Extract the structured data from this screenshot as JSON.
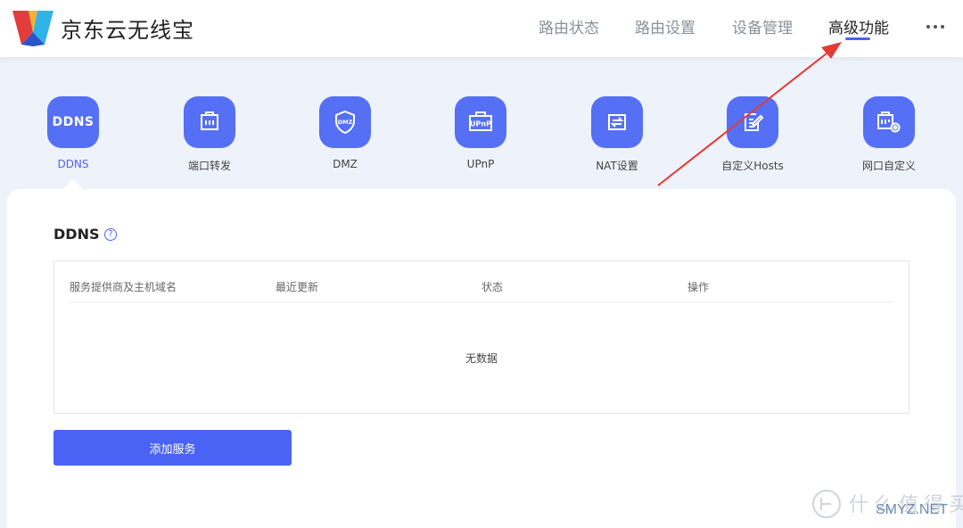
{
  "header": {
    "brand": "京东云无线宝",
    "nav": [
      {
        "label": "路由状态"
      },
      {
        "label": "路由设置"
      },
      {
        "label": "设备管理"
      },
      {
        "label": "高级功能"
      }
    ]
  },
  "tabs": [
    {
      "label": "DDNS",
      "icon_text": "DDNS"
    },
    {
      "label": "端口转发"
    },
    {
      "label": "DMZ",
      "icon_text": "DMZ"
    },
    {
      "label": "UPnP",
      "icon_text": "UPnP"
    },
    {
      "label": "NAT设置"
    },
    {
      "label": "自定义Hosts"
    },
    {
      "label": "网口自定义"
    }
  ],
  "section": {
    "title": "DDNS",
    "help_symbol": "?"
  },
  "table": {
    "columns": [
      "服务提供商及主机域名",
      "最近更新",
      "状态",
      "操作"
    ],
    "empty_text": "无数据"
  },
  "add_button": "添加服务",
  "watermark": {
    "text": "什么值得买",
    "site": "SMYZ.NET"
  },
  "colors": {
    "accent": "#4a63f5",
    "icon_bg": "#5570f4",
    "annotation": "#e53935"
  }
}
